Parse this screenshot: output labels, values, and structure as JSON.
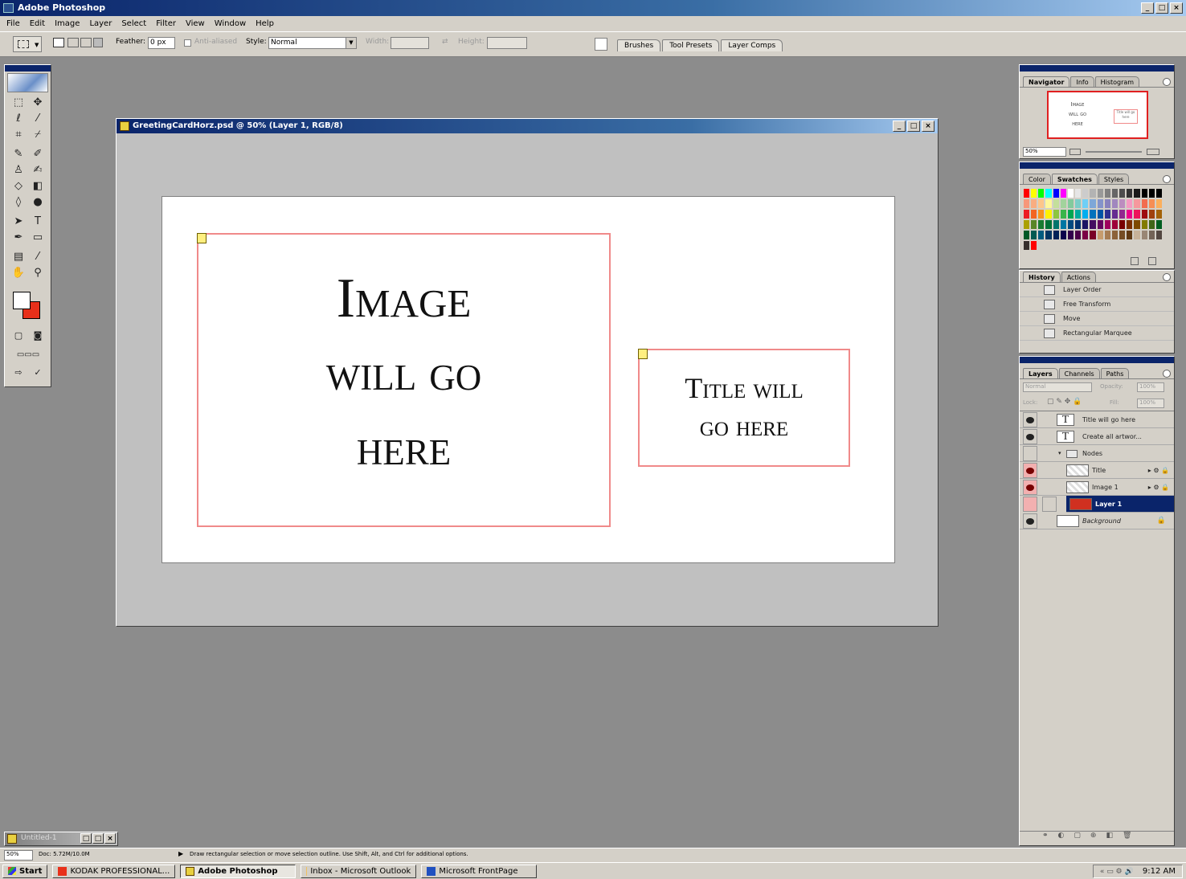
{
  "app": {
    "title": "Adobe Photoshop",
    "window_buttons": [
      "_",
      "□",
      "×"
    ]
  },
  "menu": [
    "File",
    "Edit",
    "Image",
    "Layer",
    "Select",
    "Filter",
    "View",
    "Window",
    "Help"
  ],
  "options": {
    "feather_label": "Feather:",
    "feather_value": "0 px",
    "antialiased_label": "Anti-aliased",
    "style_label": "Style:",
    "style_value": "Normal",
    "width_label": "Width:",
    "height_label": "Height:",
    "well_tabs": [
      "Brushes",
      "Tool Presets",
      "Layer Comps"
    ]
  },
  "document": {
    "title": "GreetingCardHorz.psd @ 50% (Layer 1, RGB/8)",
    "image_lines": [
      "Image",
      "will go",
      "here"
    ],
    "title_lines": [
      "Title will",
      "go here"
    ]
  },
  "navigator": {
    "tabs": [
      "Navigator",
      "Info",
      "Histogram"
    ],
    "zoom": "50%",
    "thumb_lines": [
      "Image",
      "will go",
      "here"
    ],
    "thumb_title": "Title will go here"
  },
  "swatches": {
    "tabs": [
      "Color",
      "Swatches",
      "Styles"
    ],
    "colors": [
      "#ff0000",
      "#ffff00",
      "#00ff00",
      "#00ffff",
      "#0000ff",
      "#ff00ff",
      "#ffffff",
      "#e6e6e6",
      "#cccccc",
      "#b3b3b3",
      "#999999",
      "#808080",
      "#666666",
      "#4d4d4d",
      "#333333",
      "#1a1a1a",
      "#000000",
      "#000000",
      "#000000",
      "#f7977a",
      "#f9ad81",
      "#fdc68a",
      "#fff79a",
      "#c4df9b",
      "#a2d39c",
      "#82ca9d",
      "#7bcdc8",
      "#6ecff6",
      "#7ea7d8",
      "#8493ca",
      "#8882be",
      "#a187be",
      "#bc8dbf",
      "#f49ac2",
      "#f6989d",
      "#f26c4f",
      "#f68e55",
      "#fbaf5c",
      "#ed1c24",
      "#f26522",
      "#f7941d",
      "#fff200",
      "#8dc63f",
      "#39b54a",
      "#00a651",
      "#00a99d",
      "#00aeef",
      "#0072bc",
      "#0054a6",
      "#2e3192",
      "#662d91",
      "#92278f",
      "#ec008c",
      "#ed145b",
      "#9e0b0f",
      "#a0410d",
      "#a36209",
      "#aba000",
      "#598527",
      "#197b30",
      "#007236",
      "#00746b",
      "#0076a3",
      "#004a80",
      "#003471",
      "#1b1464",
      "#440e62",
      "#630460",
      "#9e005d",
      "#9e0039",
      "#790000",
      "#7b2e00",
      "#7d4900",
      "#827b00",
      "#406618",
      "#005e20",
      "#005826",
      "#005952",
      "#005b7f",
      "#003663",
      "#002157",
      "#0d004c",
      "#32004b",
      "#4b0049",
      "#7b0046",
      "#7a0026",
      "#c69c6d",
      "#a67c52",
      "#8c6239",
      "#754c24",
      "#603913",
      "#c7b299",
      "#998675",
      "#736357",
      "#534741",
      "#362f2d",
      "#ff0000"
    ]
  },
  "history": {
    "tabs": [
      "History",
      "Actions"
    ],
    "items": [
      "Layer Order",
      "Free Transform",
      "Move",
      "Rectangular Marquee"
    ]
  },
  "layers": {
    "tabs": [
      "Layers",
      "Channels",
      "Paths"
    ],
    "blend": "Normal",
    "opacity_label": "Opacity:",
    "opacity": "100%",
    "lock_label": "Lock:",
    "fill_label": "Fill:",
    "fill": "100%",
    "rows": [
      {
        "name": "Title will go here",
        "type": "text"
      },
      {
        "name": "Create all artwor...",
        "type": "text"
      },
      {
        "name": "Nodes",
        "type": "group"
      },
      {
        "name": "Title",
        "type": "layer"
      },
      {
        "name": "Image 1",
        "type": "layer"
      },
      {
        "name": "Layer 1",
        "type": "selected"
      },
      {
        "name": "Background",
        "type": "background"
      }
    ]
  },
  "minidoc": {
    "title": "Untitled-1"
  },
  "status": {
    "zoom": "50%",
    "doc": "Doc: 5.72M/10.0M",
    "hint": "Draw rectangular selection or move selection outline.  Use Shift, Alt, and Ctrl for additional options."
  },
  "taskbar": {
    "start": "Start",
    "items": [
      "KODAK PROFESSIONAL...",
      "Adobe Photoshop",
      "Inbox - Microsoft Outlook",
      "Microsoft FrontPage"
    ],
    "time": "9:12 AM"
  },
  "colors": {
    "foreground": "#ffffff",
    "background": "#e8301a",
    "placeholder_border": "#f08a8a"
  }
}
